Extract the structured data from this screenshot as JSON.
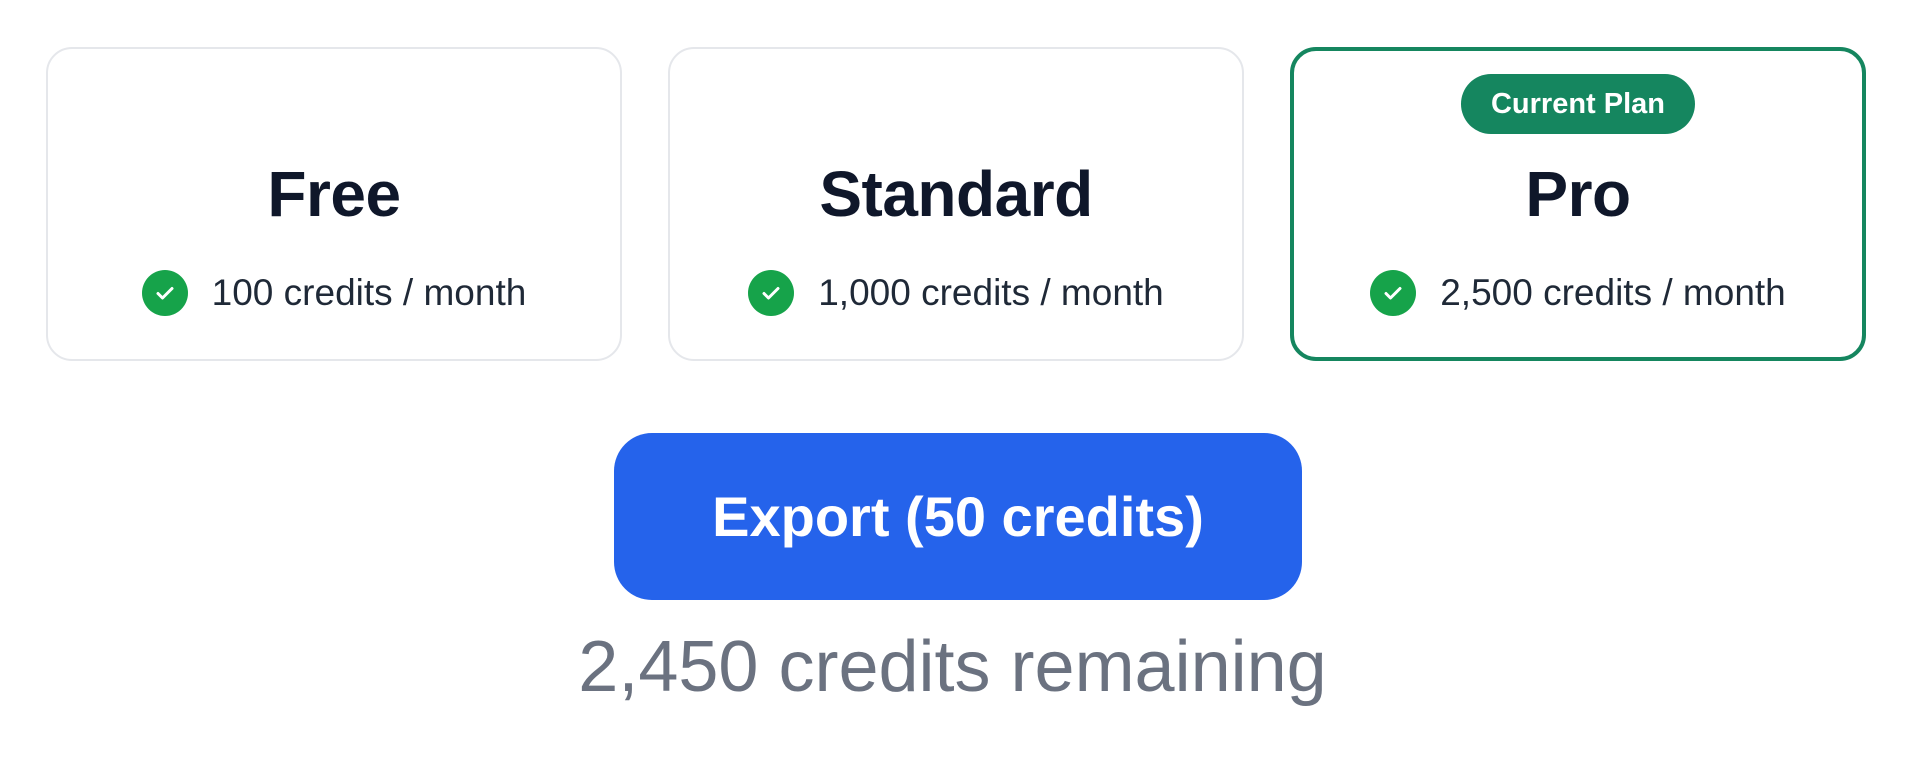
{
  "plans": [
    {
      "name": "Free",
      "feature": "100 credits / month",
      "current": false
    },
    {
      "name": "Standard",
      "feature": "1,000 credits / month",
      "current": false
    },
    {
      "name": "Pro",
      "feature": "2,500 credits / month",
      "current": true,
      "badge": "Current Plan"
    }
  ],
  "export_button": {
    "label": "Export (50 credits)"
  },
  "credits_remaining": "2,450 credits remaining",
  "colors": {
    "accent_green": "#15865f",
    "check_green": "#16a34a",
    "primary_blue": "#2563eb",
    "muted_text": "#6b7280"
  },
  "icons": {
    "feature": "check-circle-icon"
  }
}
